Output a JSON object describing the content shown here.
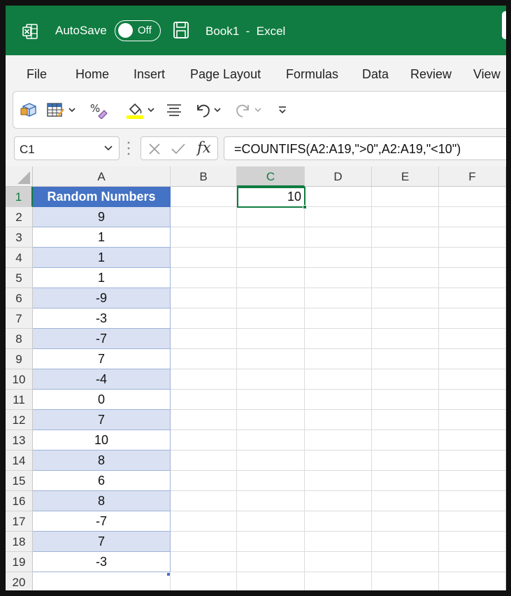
{
  "titlebar": {
    "autosave_label": "AutoSave",
    "autosave_state": "Off",
    "doc_title": "Book1  -  Excel",
    "accent": "#107c41"
  },
  "menu": [
    "File",
    "Home",
    "Insert",
    "Page Layout",
    "Formulas",
    "Data",
    "Review",
    "View"
  ],
  "toolbar": {
    "icons": [
      "3d-box-icon",
      "table-style-icon",
      "percent-style-icon",
      "fill-color-icon",
      "align-icon",
      "undo-icon",
      "redo-icon",
      "customize-toolbar-icon"
    ],
    "fill_color": "#ffff00"
  },
  "formula_bar": {
    "name_box": "C1",
    "fx_label": "fx",
    "formula": "=COUNTIFS(A2:A19,\">0\",A2:A19,\"<10\")"
  },
  "sheet": {
    "columns": [
      "A",
      "B",
      "C",
      "D",
      "E",
      "F"
    ],
    "selected_column": "C",
    "selected_row": 1,
    "rows": [
      "1",
      "2",
      "3",
      "4",
      "5",
      "6",
      "7",
      "8",
      "9",
      "10",
      "11",
      "12",
      "13",
      "14",
      "15",
      "16",
      "17",
      "18",
      "19",
      "20"
    ],
    "a_header": "Random Numbers",
    "a_values": [
      "9",
      "1",
      "1",
      "1",
      "-9",
      "-3",
      "-7",
      "7",
      "-4",
      "0",
      "7",
      "10",
      "8",
      "6",
      "8",
      "-7",
      "7",
      "-3"
    ],
    "c1_value": "10",
    "header_color": "#4472c4",
    "band_color": "#d9e1f2"
  }
}
